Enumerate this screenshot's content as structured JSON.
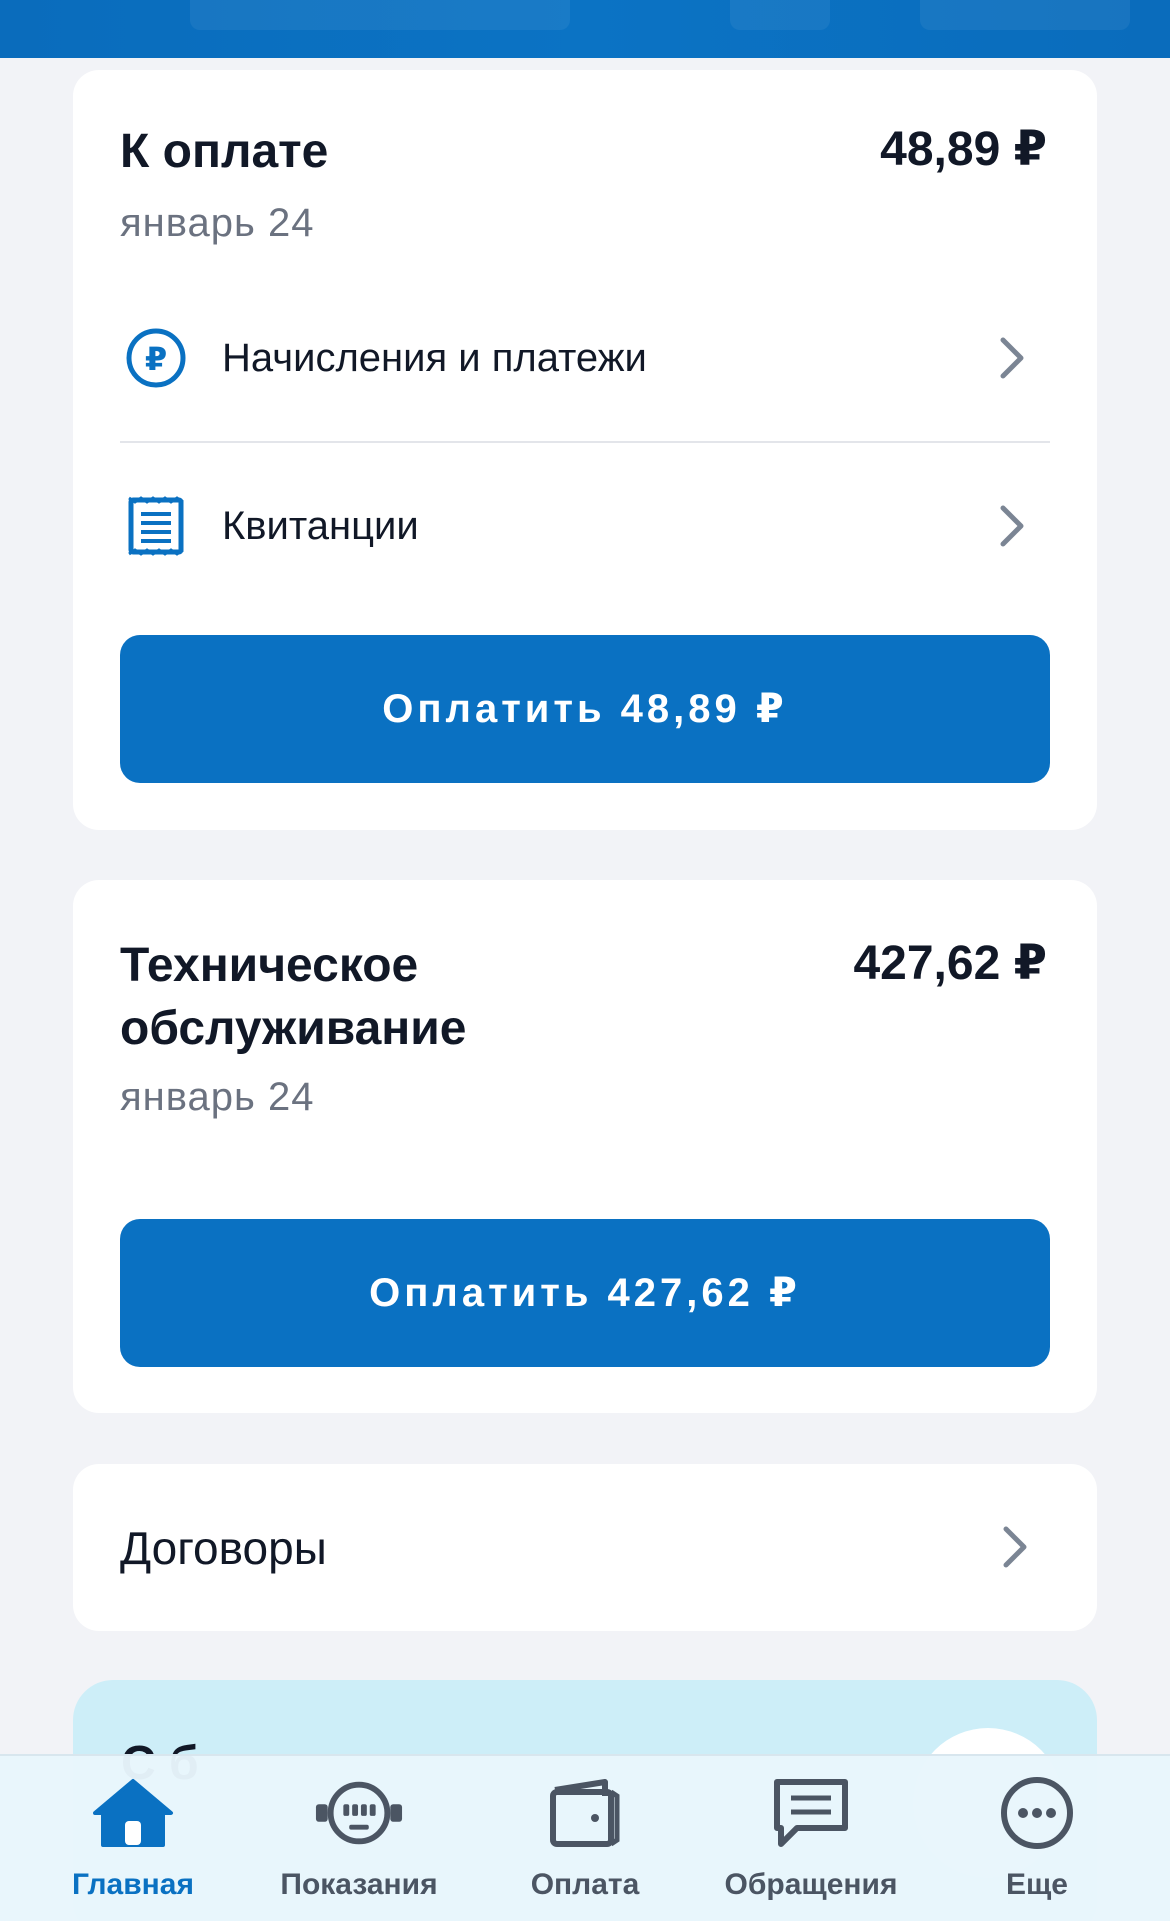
{
  "payment_card": {
    "title": "К оплате",
    "period": "январь 24",
    "amount": "48,89 ₽",
    "rows": [
      {
        "label": "Начисления и платежи",
        "icon": "ruble-circle-icon"
      },
      {
        "label": "Квитанции",
        "icon": "receipt-icon"
      }
    ],
    "pay_button": "Оплатить 48,89 ₽"
  },
  "maintenance_card": {
    "title_line1": "Техническое",
    "title_line2": "обслуживание",
    "period": "январь 24",
    "amount": "427,62 ₽",
    "pay_button": "Оплатить 427,62 ₽"
  },
  "contracts_card": {
    "label": "Договоры"
  },
  "promo_card": {
    "visible_fragment": "С        б"
  },
  "bottom_nav": {
    "items": [
      {
        "label": "Главная",
        "icon": "home-icon",
        "active": true
      },
      {
        "label": "Показания",
        "icon": "meter-icon",
        "active": false
      },
      {
        "label": "Оплата",
        "icon": "wallet-icon",
        "active": false
      },
      {
        "label": "Обращения",
        "icon": "chat-icon",
        "active": false
      },
      {
        "label": "Еще",
        "icon": "more-icon",
        "active": false
      }
    ]
  },
  "colors": {
    "accent": "#0a71c2",
    "top_bar": "#0a6cbc",
    "background": "#f2f3f7",
    "card": "#ffffff",
    "secondary_text": "#6b7280",
    "promo_bg": "#cdeef8"
  }
}
